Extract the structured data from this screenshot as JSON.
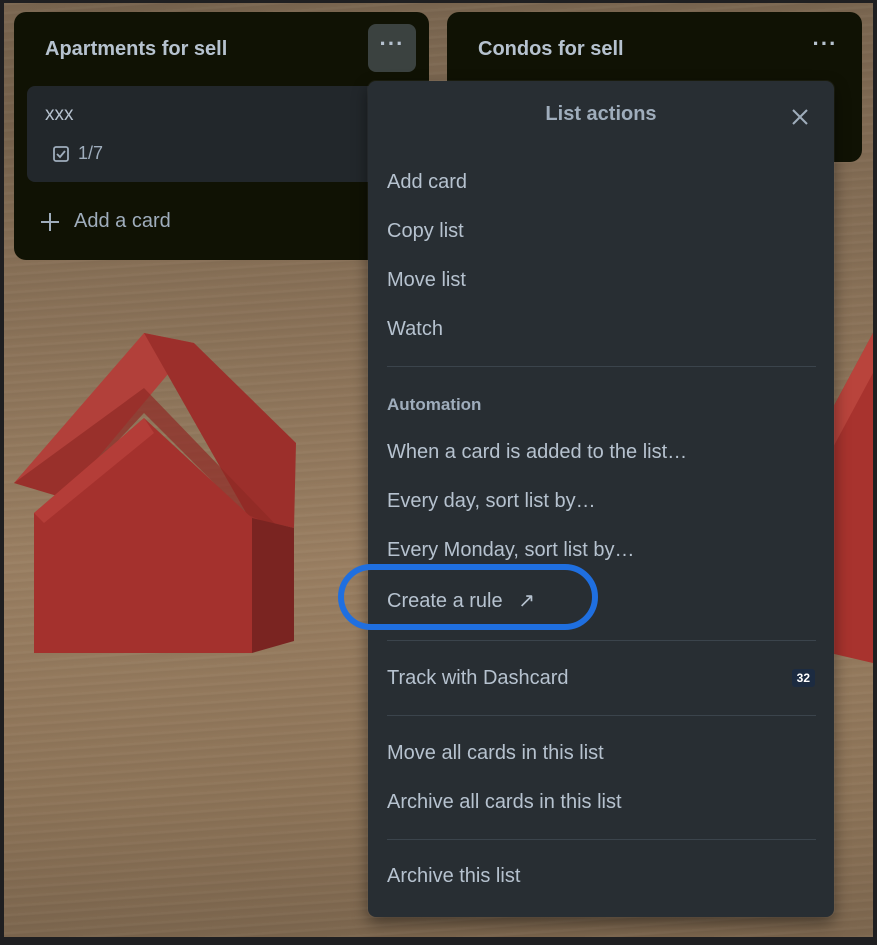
{
  "lists": [
    {
      "title": "Apartments for sell",
      "cards": [
        {
          "title": "xxx",
          "checklist": "1/7",
          "checklist_icon": "checkbox-icon"
        }
      ],
      "add_card_label": "Add a card",
      "menu_icon": "more-dots-icon",
      "menu_label": "···"
    },
    {
      "title": "Condos for sell",
      "menu_icon": "more-dots-icon",
      "menu_label": "···"
    }
  ],
  "menu": {
    "title": "List actions",
    "close_icon": "close-icon",
    "items_top": [
      "Add card",
      "Copy list",
      "Move list",
      "Watch"
    ],
    "automation_label": "Automation",
    "automation_items": [
      "When a card is added to the list…",
      "Every day, sort list by…",
      "Every Monday, sort list by…"
    ],
    "create_rule": {
      "label": "Create a rule",
      "icon": "external-arrow-icon",
      "arrow": "↗"
    },
    "dashcard": {
      "label": "Track with Dashcard",
      "badge": "32"
    },
    "bulk_items": [
      "Move all cards in this list",
      "Archive all cards in this list"
    ],
    "archive_list": "Archive this list"
  },
  "colors": {
    "list_bg": "#101204",
    "menu_bg": "#282e33",
    "card_bg": "#22272b",
    "text": "#b6c2cf",
    "highlight": "#1f6fe0",
    "house_red": "#a8332e"
  }
}
